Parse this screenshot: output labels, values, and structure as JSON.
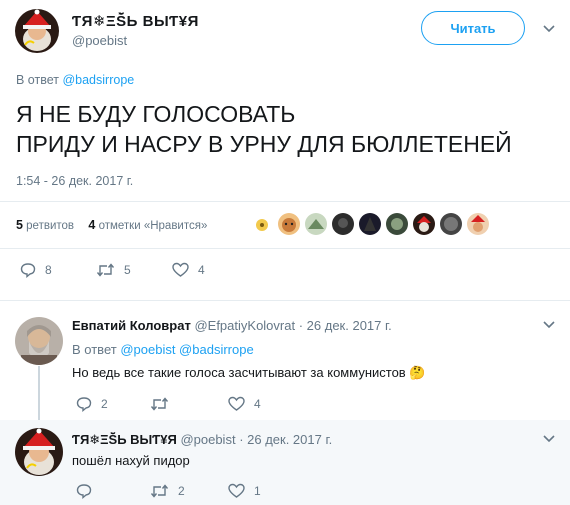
{
  "main_tweet": {
    "display_name": "ƬЯ❄ΞŠ̃Ь ВЫƬ¥Я",
    "handle": "@poebist",
    "follow_label": "Читать",
    "reply_to_prefix": "В ответ",
    "reply_to_handle": "@badsirrope",
    "text_line1": "Я НЕ БУДУ ГОЛОСОВАТЬ",
    "text_line2": "ПРИДУ И НАСРУ В УРНУ ДЛЯ БЮЛЛЕТЕНЕЙ",
    "timestamp": "1:54 - 26 дек. 2017 г.",
    "retweets_count": "5",
    "retweets_label": "ретвитов",
    "likes_count": "4",
    "likes_label": "отметки «Нравится»",
    "actions": {
      "replies": "8",
      "retweets": "5",
      "likes": "4"
    }
  },
  "replies": [
    {
      "display_name": "Евпатий Коловрат",
      "handle": "@EfpatiyKolovrat",
      "date": "· 26 дек. 2017 г.",
      "reply_to_prefix": "В ответ",
      "reply_to_handles": "@poebist @badsirrope",
      "text": "Но ведь все такие голоса засчитывают за коммунистов",
      "emoji": "🤔",
      "actions": {
        "replies": "2",
        "retweets": "",
        "likes": "4"
      }
    },
    {
      "display_name": "ƬЯ❄ΞŠ̃Ь ВЫƬ¥Я",
      "handle": "@poebist",
      "date": "· 26 дек. 2017 г.",
      "text": "пошёл нахуй пидор",
      "actions": {
        "replies": "",
        "retweets": "2",
        "likes": "1"
      }
    }
  ],
  "colors": {
    "accent": "#1da1f2",
    "muted": "#657786",
    "like_red": "#e0245e"
  }
}
